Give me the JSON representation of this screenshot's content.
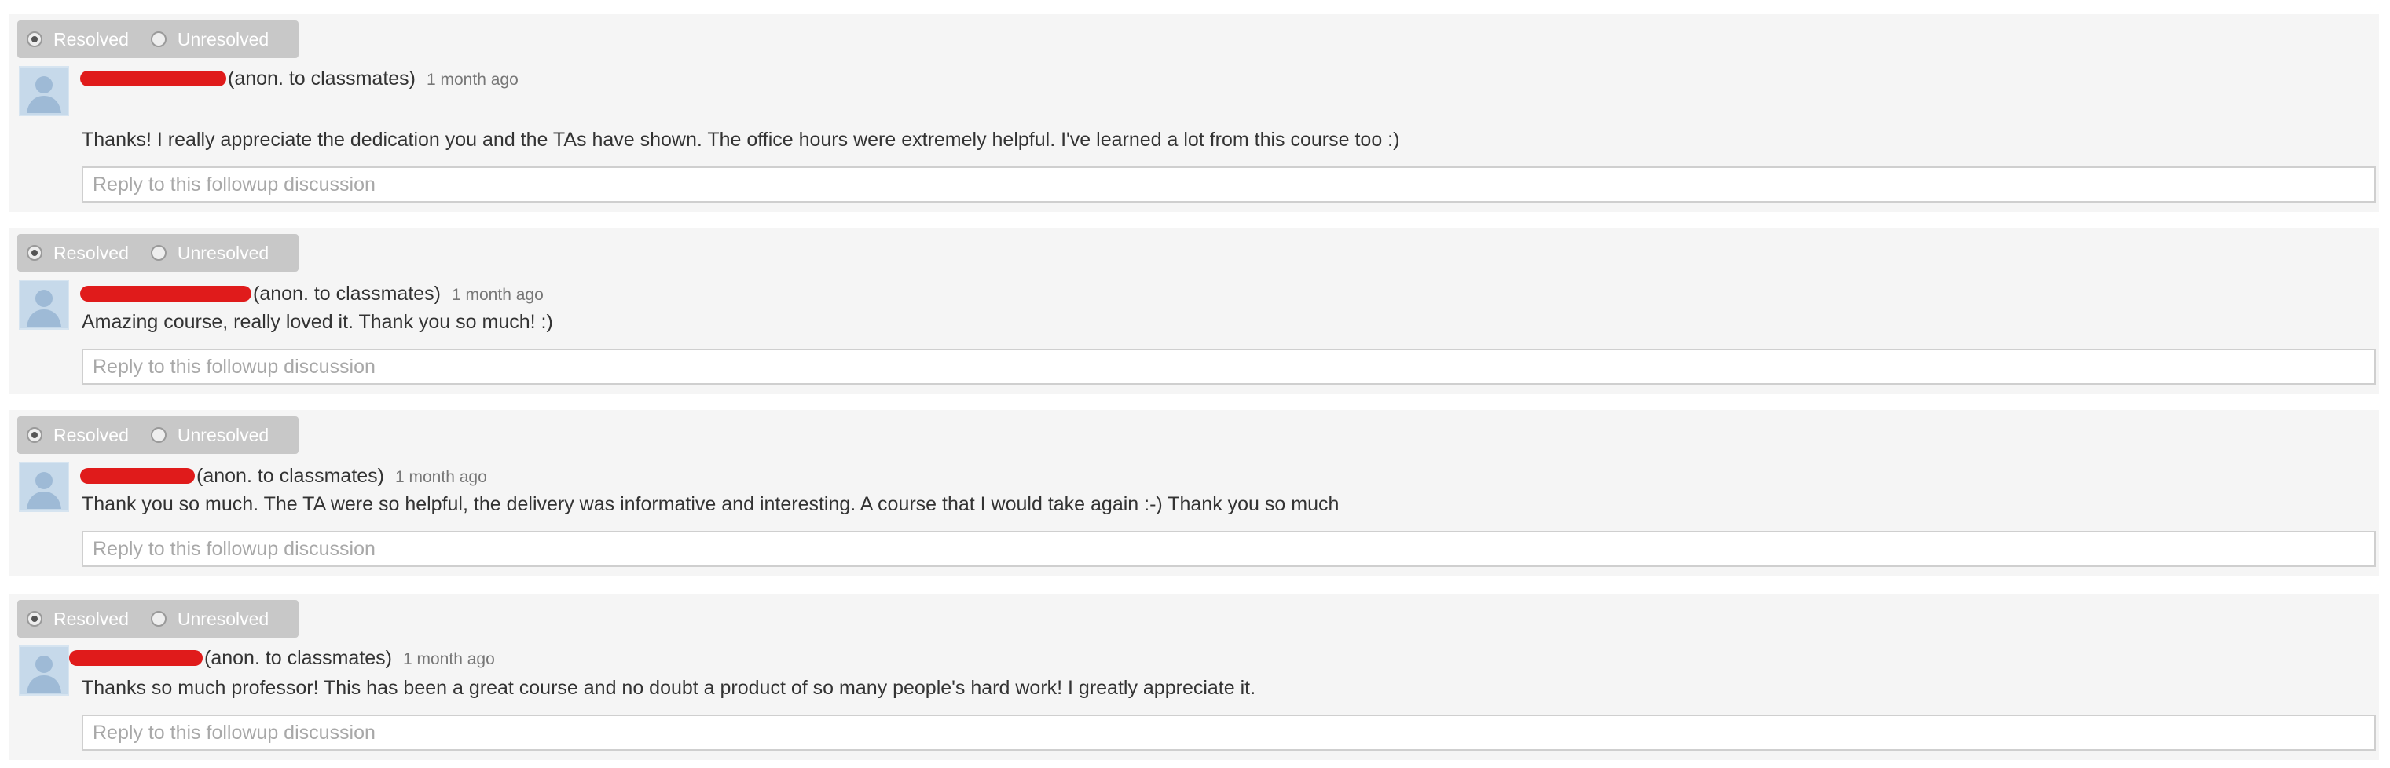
{
  "colors": {
    "panel_bg": "#f5f5f5",
    "toggle_bg": "#c8c8c8",
    "redaction": "#e01b1b",
    "avatar_bg": "#c6d9ea"
  },
  "icons": {
    "avatar": "default-user-avatar-icon",
    "radio": "radio-button-icon"
  },
  "followups": [
    {
      "resolved_label": "Resolved",
      "unresolved_label": "Unresolved",
      "selected": "Resolved",
      "author_suffix": "(anon. to classmates)",
      "time": "1 month ago",
      "text": "Thanks! I really appreciate the dedication you and the TAs have shown. The office hours were extremely helpful. I've learned a lot from this course too :)",
      "reply_placeholder": "Reply to this followup discussion"
    },
    {
      "resolved_label": "Resolved",
      "unresolved_label": "Unresolved",
      "selected": "Resolved",
      "author_suffix": "(anon. to classmates)",
      "time": "1 month ago",
      "text": "Amazing course, really loved it. Thank you so much! :)",
      "reply_placeholder": "Reply to this followup discussion"
    },
    {
      "resolved_label": "Resolved",
      "unresolved_label": "Unresolved",
      "selected": "Resolved",
      "author_suffix": "(anon. to classmates)",
      "time": "1 month ago",
      "text": "Thank you so much. The TA were so helpful, the delivery was informative and interesting. A course that I would take again :-) Thank you so much",
      "reply_placeholder": "Reply to this followup discussion"
    },
    {
      "resolved_label": "Resolved",
      "unresolved_label": "Unresolved",
      "selected": "Resolved",
      "author_suffix": "(anon. to classmates)",
      "time": "1 month ago",
      "text": "Thanks so much professor! This has been a great course and no doubt a product of so many people's hard work! I greatly appreciate it.",
      "reply_placeholder": "Reply to this followup discussion"
    }
  ]
}
